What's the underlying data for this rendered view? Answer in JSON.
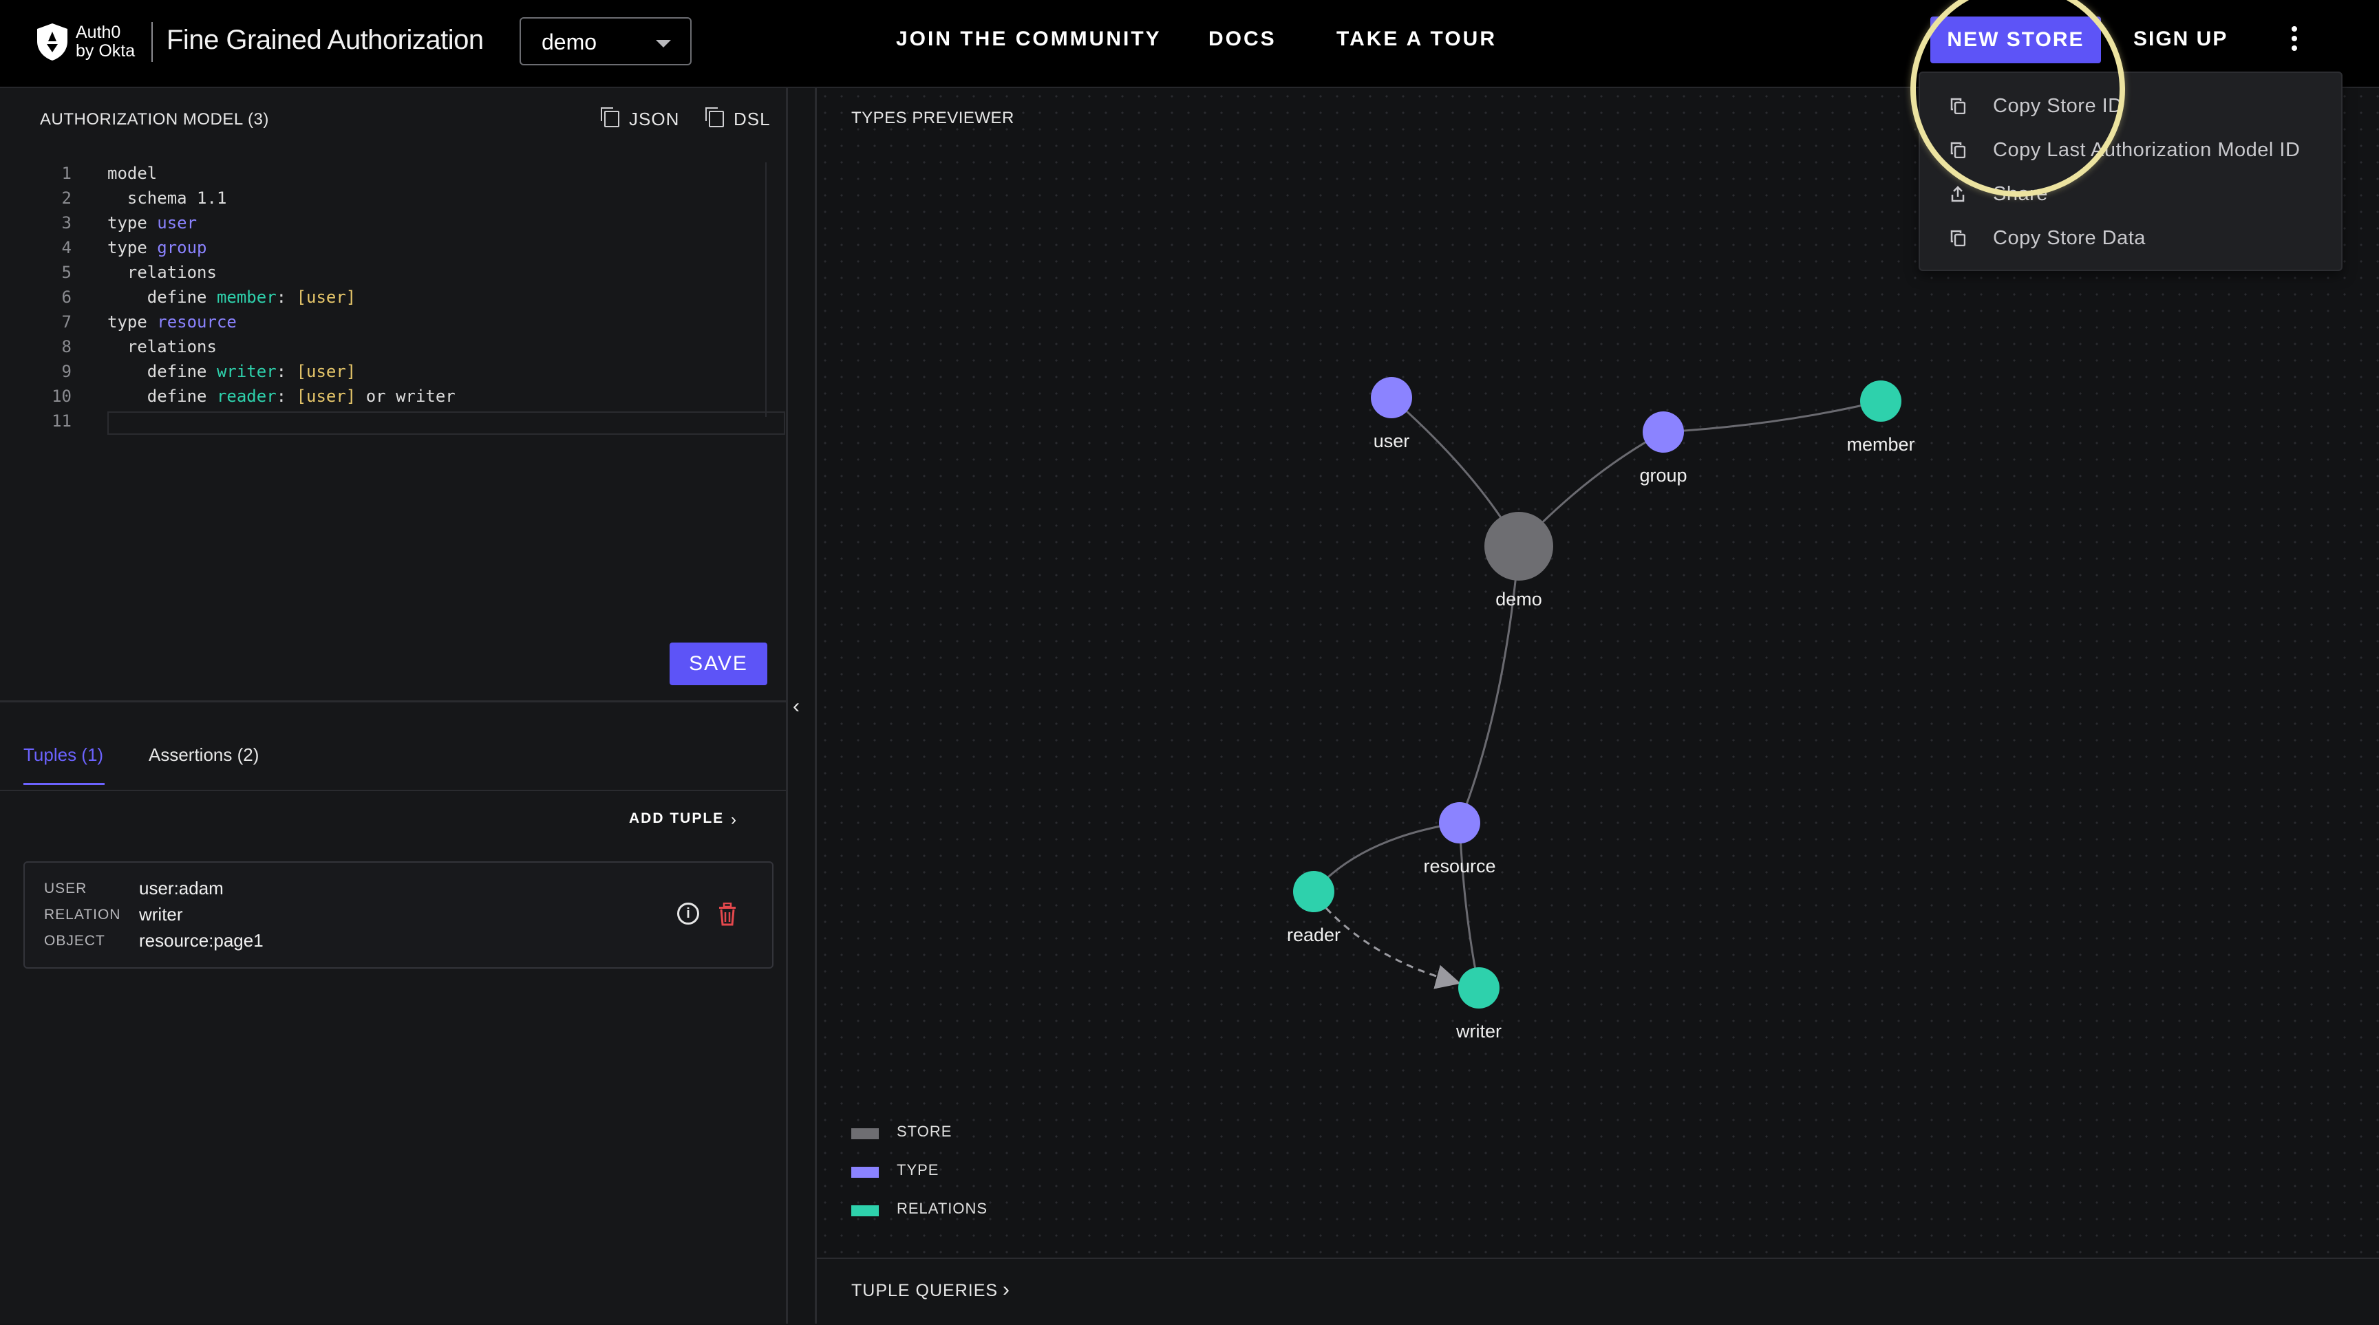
{
  "header": {
    "logo_line1": "Auth0",
    "logo_line2": "by Okta",
    "app_title": "Fine Grained Authorization",
    "store_selected": "demo",
    "nav": [
      "JOIN  THE COMMUNITY",
      "DOCS",
      "TAKE A  TOUR"
    ],
    "new_store_label": "NEW STORE",
    "sign_up_label": "SIGN UP",
    "more_icon": "kebab-menu-icon"
  },
  "menu": {
    "items": [
      {
        "label": "Copy Store ID",
        "icon": "copy-icon"
      },
      {
        "label": "Copy Last Authorization Model ID",
        "icon": "copy-icon"
      },
      {
        "label": "Share",
        "icon": "share-icon"
      },
      {
        "label": "Copy Store Data",
        "icon": "copy-icon"
      }
    ]
  },
  "model_panel": {
    "title": "AUTHORIZATION MODEL (3)",
    "json_label": "JSON",
    "dsl_label": "DSL",
    "save_label": "SAVE",
    "line_numbers": [
      "1",
      "2",
      "3",
      "4",
      "5",
      "6",
      "7",
      "8",
      "9",
      "10",
      "11"
    ],
    "code": {
      "l1": "model",
      "l2_kw": "  schema ",
      "l2_val": "1.1",
      "l3_kw": "type ",
      "l3_type": "user",
      "l4_kw": "type ",
      "l4_type": "group",
      "l5": "  relations",
      "l6_kw": "    define ",
      "l6_rel": "member",
      "l6_colon": ": ",
      "l6_users": "[user]",
      "l7_kw": "type ",
      "l7_type": "resource",
      "l8": "  relations",
      "l9_kw": "    define ",
      "l9_rel": "writer",
      "l9_colon": ": ",
      "l9_users": "[user]",
      "l10_kw": "    define ",
      "l10_rel": "reader",
      "l10_colon": ": ",
      "l10_users": "[user]",
      "l10_rest": " or writer"
    }
  },
  "tuples_panel": {
    "tab_tuples": "Tuples (1)",
    "tab_assertions": "Assertions (2)",
    "add_tuple_label": "ADD TUPLE",
    "tuple": {
      "user_key": "USER",
      "user_val": "user:adam",
      "relation_key": "RELATION",
      "relation_val": "writer",
      "object_key": "OBJECT",
      "object_val": "resource:page1"
    }
  },
  "types_previewer": {
    "title": "TYPES PREVIEWER",
    "nodes": [
      {
        "id": "demo",
        "label": "demo",
        "kind": "store"
      },
      {
        "id": "user",
        "label": "user",
        "kind": "type"
      },
      {
        "id": "group",
        "label": "group",
        "kind": "type"
      },
      {
        "id": "member",
        "label": "member",
        "kind": "relation"
      },
      {
        "id": "resource",
        "label": "resource",
        "kind": "type"
      },
      {
        "id": "reader",
        "label": "reader",
        "kind": "relation"
      },
      {
        "id": "writer",
        "label": "writer",
        "kind": "relation"
      }
    ],
    "edges": [
      {
        "from": "demo",
        "to": "user"
      },
      {
        "from": "demo",
        "to": "group"
      },
      {
        "from": "group",
        "to": "member"
      },
      {
        "from": "demo",
        "to": "resource"
      },
      {
        "from": "resource",
        "to": "reader"
      },
      {
        "from": "resource",
        "to": "writer"
      },
      {
        "from": "reader",
        "to": "writer",
        "style": "dashed-arrow"
      }
    ],
    "legend": [
      {
        "label": "STORE",
        "color": "#6e6e72"
      },
      {
        "label": "TYPE",
        "color": "#8b83ff"
      },
      {
        "label": "RELATIONS",
        "color": "#2ed1ac"
      }
    ],
    "colors": {
      "store": "#6e6e72",
      "type": "#8b83ff",
      "relation": "#2ed1ac"
    },
    "tuple_queries_label": "TUPLE QUERIES"
  }
}
